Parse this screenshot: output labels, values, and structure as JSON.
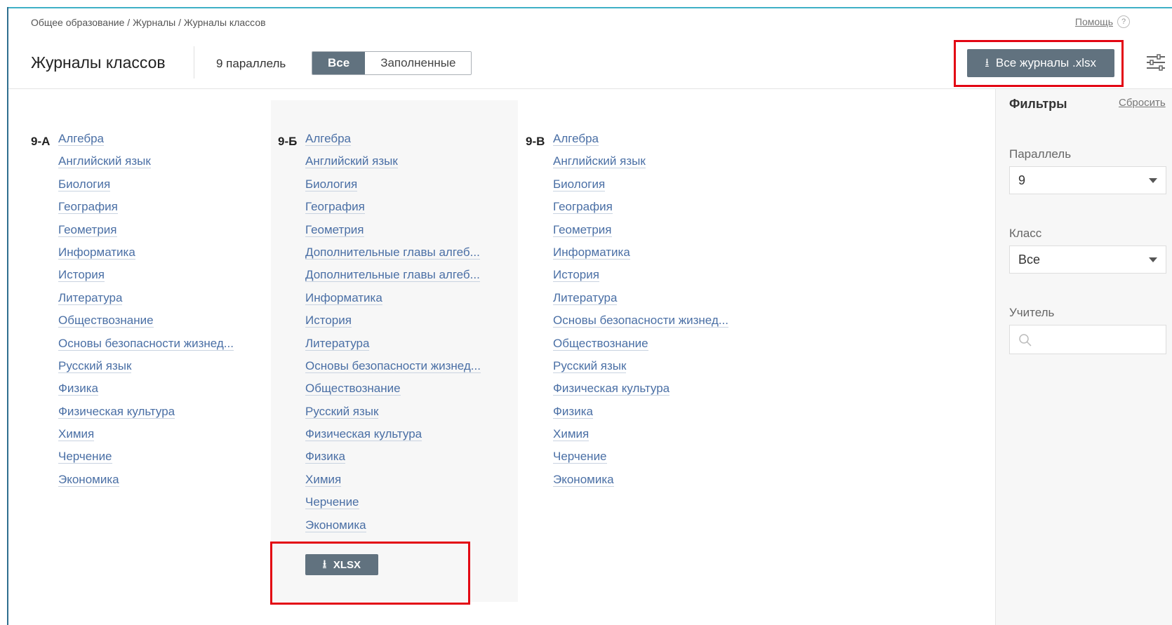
{
  "breadcrumb": "Общее образование / Журналы / Журналы классов",
  "help": {
    "label": "Помощь",
    "icon": "?"
  },
  "header": {
    "title": "Журналы классов",
    "parallel_label": "9 параллель",
    "toggle": {
      "all": "Все",
      "filled": "Заполненные",
      "active": "Все"
    },
    "export_all_label": "Все журналы .xlsx"
  },
  "sidebar": {
    "title": "Фильтры",
    "reset": "Сбросить",
    "parallel": {
      "label": "Параллель",
      "value": "9"
    },
    "class": {
      "label": "Класс",
      "value": "Все"
    },
    "teacher": {
      "label": "Учитель",
      "placeholder": ""
    }
  },
  "classes": [
    {
      "name": "9-А",
      "subjects": [
        "Алгебра",
        "Английский язык",
        "Биология",
        "География",
        "Геометрия",
        "Информатика",
        "История",
        "Литература",
        "Обществознание",
        "Основы безопасности жизнед...",
        "Русский язык",
        "Физика",
        "Физическая культура",
        "Химия",
        "Черчение",
        "Экономика"
      ]
    },
    {
      "name": "9-Б",
      "subjects": [
        "Алгебра",
        "Английский язык",
        "Биология",
        "География",
        "Геометрия",
        "Дополнительные главы алгеб...",
        "Дополнительные главы алгеб...",
        "Информатика",
        "История",
        "Литература",
        "Основы безопасности жизнед...",
        "Обществознание",
        "Русский язык",
        "Физическая культура",
        "Физика",
        "Химия",
        "Черчение",
        "Экономика"
      ]
    },
    {
      "name": "9-В",
      "subjects": [
        "Алгебра",
        "Английский язык",
        "Биология",
        "География",
        "Геометрия",
        "Информатика",
        "История",
        "Литература",
        "Основы безопасности жизнед...",
        "Обществознание",
        "Русский язык",
        "Физическая культура",
        "Физика",
        "Химия",
        "Черчение",
        "Экономика"
      ]
    }
  ],
  "xlsx_button_label": "XLSX",
  "colors": {
    "button": "#61727f",
    "link": "#4a6fa5",
    "highlight": "#e30613",
    "accent_top": "#3fb0c6"
  }
}
